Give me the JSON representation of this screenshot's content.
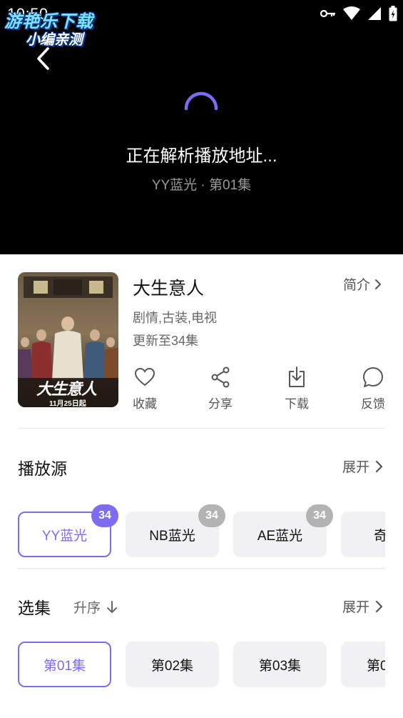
{
  "status_bar": {
    "time": "10:50",
    "icons": [
      "key-icon",
      "wifi-icon",
      "signal-icon",
      "battery-icon"
    ]
  },
  "watermark": {
    "line1": "游艳乐下载",
    "line2": "小编亲测"
  },
  "player": {
    "loading_text": "正在解析播放地址...",
    "source_text": "YY蓝光 · 第01集",
    "accent_color": "#7b6cf0"
  },
  "show": {
    "title": "大生意人",
    "intro_label": "简介",
    "genre": "剧情,古装,电视",
    "update_status": "更新至34集",
    "poster": {
      "title_text": "大生意人",
      "date_text": "11月25日起"
    }
  },
  "actions": [
    {
      "label": "收藏",
      "icon": "heart-icon"
    },
    {
      "label": "分享",
      "icon": "share-icon"
    },
    {
      "label": "下载",
      "icon": "download-icon"
    },
    {
      "label": "反馈",
      "icon": "feedback-icon"
    }
  ],
  "sources": {
    "title": "播放源",
    "expand_label": "展开",
    "items": [
      {
        "label": "YY蓝光",
        "count": "34",
        "active": true
      },
      {
        "label": "NB蓝光",
        "count": "34",
        "active": false
      },
      {
        "label": "AE蓝光",
        "count": "34",
        "active": false
      },
      {
        "label": "奇",
        "count": "",
        "active": false
      }
    ]
  },
  "episodes": {
    "title": "选集",
    "sort_label": "升序",
    "expand_label": "展开",
    "items": [
      {
        "label": "第01集",
        "active": true
      },
      {
        "label": "第02集",
        "active": false
      },
      {
        "label": "第03集",
        "active": false
      },
      {
        "label": "第0",
        "active": false
      }
    ]
  }
}
